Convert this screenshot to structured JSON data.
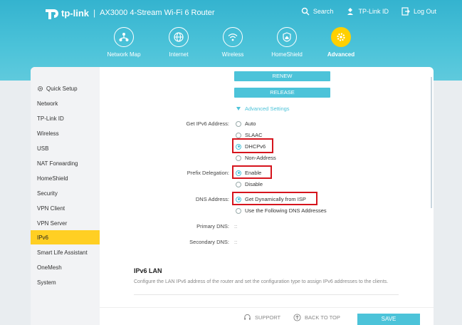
{
  "header": {
    "brand": "tp-link",
    "separator": "|",
    "model": "AX3000 4-Stream Wi-Fi 6 Router",
    "links": [
      {
        "label": "Search",
        "icon": "search-icon"
      },
      {
        "label": "TP-Link ID",
        "icon": "user-id-icon"
      },
      {
        "label": "Log Out",
        "icon": "logout-icon"
      }
    ]
  },
  "nav": {
    "items": [
      {
        "label": "Network Map",
        "icon": "network-map-icon"
      },
      {
        "label": "Internet",
        "icon": "globe-icon"
      },
      {
        "label": "Wireless",
        "icon": "wifi-icon"
      },
      {
        "label": "HomeShield",
        "icon": "shield-home-icon"
      },
      {
        "label": "Advanced",
        "icon": "gear-icon",
        "active": true
      }
    ]
  },
  "sidebar": {
    "items": [
      {
        "label": "Quick Setup",
        "icon": "gear-icon"
      },
      {
        "label": "Network"
      },
      {
        "label": "TP-Link ID"
      },
      {
        "label": "Wireless"
      },
      {
        "label": "USB"
      },
      {
        "label": "NAT Forwarding"
      },
      {
        "label": "HomeShield"
      },
      {
        "label": "Security"
      },
      {
        "label": "VPN Client"
      },
      {
        "label": "VPN Server"
      },
      {
        "label": "IPv6",
        "active": true
      },
      {
        "label": "Smart Life Assistant"
      },
      {
        "label": "OneMesh"
      },
      {
        "label": "System"
      }
    ]
  },
  "content": {
    "renew_label": "RENEW",
    "release_label": "RELEASE",
    "advanced_settings": "Advanced Settings",
    "get_ipv6_label": "Get IPv6 Address:",
    "get_ipv6_options": [
      "Auto",
      "SLAAC",
      "DHCPv6",
      "Non-Address"
    ],
    "get_ipv6_selected": "DHCPv6",
    "prefix_label": "Prefix Delegation:",
    "prefix_options": [
      "Enable",
      "Disable"
    ],
    "prefix_selected": "Enable",
    "dns_label": "DNS Address:",
    "dns_options": [
      "Get Dynamically from ISP",
      "Use the Following DNS Addresses"
    ],
    "dns_selected": "Get Dynamically from ISP",
    "primary_dns_label": "Primary DNS:",
    "primary_dns_value": "::",
    "secondary_dns_label": "Secondary DNS:",
    "secondary_dns_value": "::",
    "lan_title": "IPv6 LAN",
    "lan_desc": "Configure the LAN IPv6 address of the router and set the configuration type to assign IPv6 addresses to the clients."
  },
  "footer": {
    "support_label": "SUPPORT",
    "back_to_top_label": "BACK TO TOP",
    "save_label": "SAVE"
  },
  "colors": {
    "header": "#4cc3d9",
    "accent": "#4cc3d9",
    "active_nav": "#ffd000",
    "highlight_box": "#d6141d"
  }
}
